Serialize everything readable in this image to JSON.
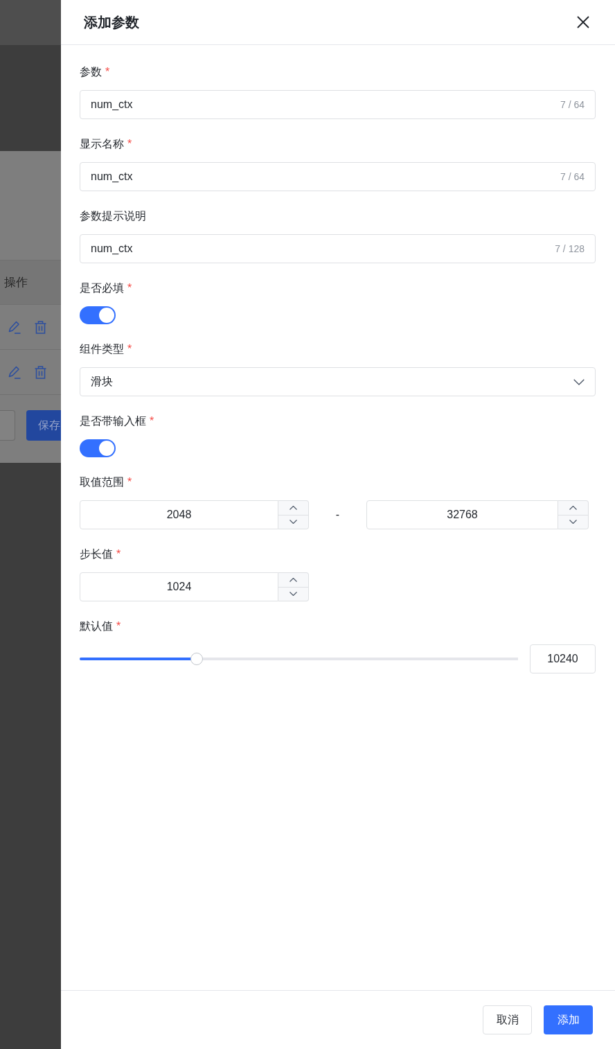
{
  "backdrop": {
    "table_header": "操作",
    "save_button": "保存"
  },
  "drawer": {
    "title": "添加参数",
    "fields": [
      {
        "kind": "text",
        "label": "参数",
        "required_mark": "*",
        "value": "num_ctx",
        "counter": "7 / 64"
      },
      {
        "kind": "text",
        "label": "显示名称",
        "required_mark": "*",
        "value": "num_ctx",
        "counter": "7 / 64"
      },
      {
        "kind": "text",
        "label": "参数提示说明",
        "value": "num_ctx",
        "counter": "7 / 128"
      },
      {
        "kind": "switch",
        "label": "是否必填",
        "required_mark": "*",
        "on": true
      },
      {
        "kind": "select",
        "label": "组件类型",
        "required_mark": "*",
        "value": "滑块"
      },
      {
        "kind": "switch",
        "label": "是否带输入框",
        "required_mark": "*",
        "on": true
      },
      {
        "kind": "range",
        "label": "取值范围",
        "required_mark": "*",
        "min": "2048",
        "separator": "-",
        "max": "32768"
      },
      {
        "kind": "number",
        "label": "步长值",
        "required_mark": "*",
        "value": "1024"
      },
      {
        "kind": "slider",
        "label": "默认值",
        "required_mark": "*",
        "level": 0.267,
        "value": "10240"
      }
    ],
    "buttons": [
      {
        "kind": "secondary",
        "label": "取消"
      },
      {
        "kind": "primary",
        "label": "添加"
      }
    ]
  }
}
